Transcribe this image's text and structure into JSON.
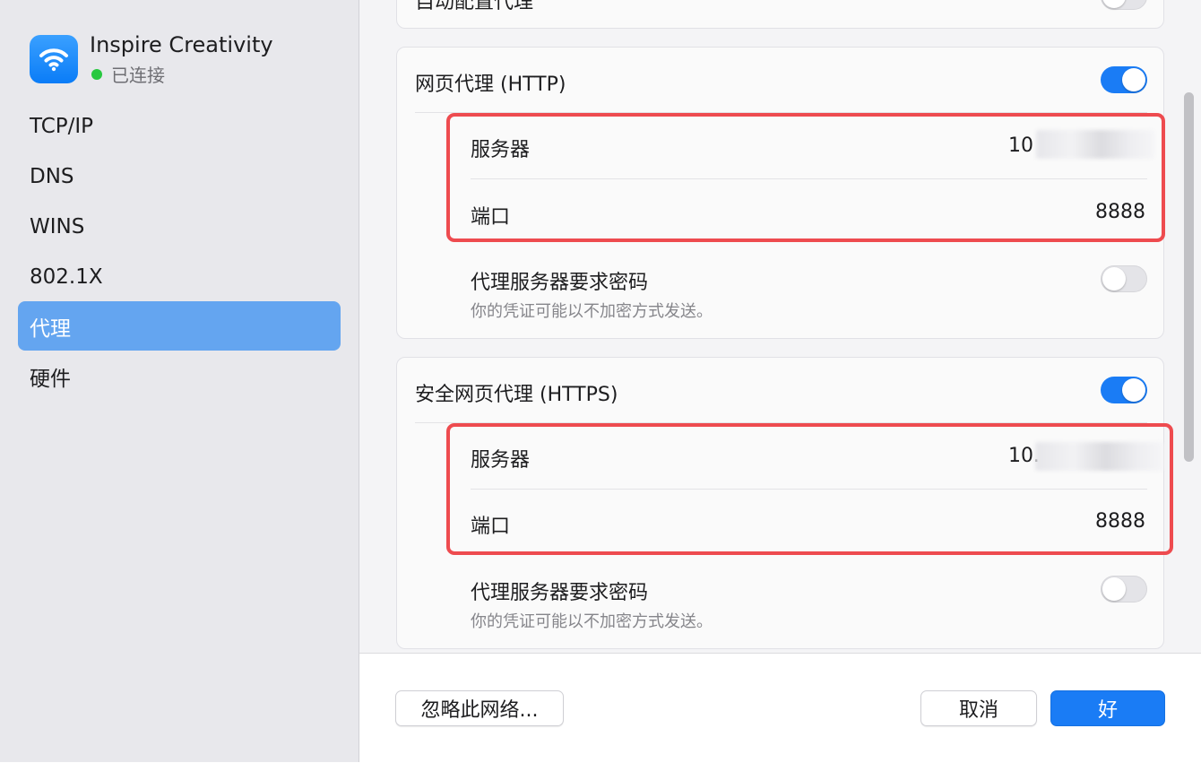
{
  "sidebar": {
    "network_name": "Inspire Creativity",
    "network_status": "已连接",
    "network_icon": "wifi-icon",
    "status_color": "#28c840",
    "items": [
      {
        "label": "TCP/IP"
      },
      {
        "label": "DNS"
      },
      {
        "label": "WINS"
      },
      {
        "label": "802.1X"
      },
      {
        "label": "代理",
        "selected": true
      },
      {
        "label": "硬件"
      }
    ]
  },
  "proxies": {
    "top_partial_label": "自动配置代理",
    "http": {
      "title": "网页代理 (HTTP)",
      "enabled": true,
      "server_label": "服务器",
      "server_value": "10",
      "port_label": "端口",
      "port_value": "8888",
      "auth_label": "代理服务器要求密码",
      "auth_note": "你的凭证可能以不加密方式发送。",
      "auth_enabled": false
    },
    "https": {
      "title": "安全网页代理 (HTTPS)",
      "enabled": true,
      "server_label": "服务器",
      "server_value": "10.",
      "port_label": "端口",
      "port_value": "8888",
      "auth_label": "代理服务器要求密码",
      "auth_note": "你的凭证可能以不加密方式发送。",
      "auth_enabled": false
    }
  },
  "footer": {
    "forget_label": "忽略此网络...",
    "cancel_label": "取消",
    "ok_label": "好"
  },
  "colors": {
    "accent": "#1a7cf5",
    "sidebar_selected": "#64a5f0",
    "highlight": "#ee4b4f"
  }
}
